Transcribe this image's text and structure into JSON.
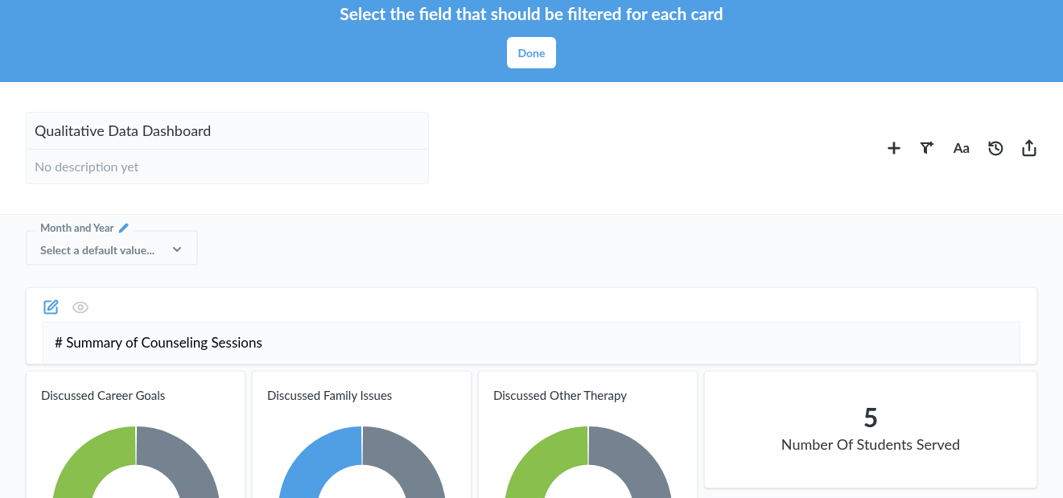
{
  "banner": {
    "title": "Select the field that should be filtered for each card",
    "button": "Done"
  },
  "dashboard": {
    "title": "Qualitative Data Dashboard",
    "description_placeholder": "No description yet"
  },
  "toolbar": [
    {
      "kind": "add"
    },
    {
      "kind": "filter"
    },
    {
      "kind": "text",
      "label": "Aa"
    },
    {
      "kind": "history"
    },
    {
      "kind": "share"
    }
  ],
  "filter": {
    "label": "Month and Year",
    "placeholder": "Select a default value..."
  },
  "text_card": {
    "content": "# Summary of Counseling Sessions"
  },
  "cards": [
    {
      "kind": "donut",
      "title": "Discussed Career Goals",
      "color": "#88bf4d"
    },
    {
      "kind": "donut",
      "title": "Discussed Family Issues",
      "color": "#509ee3"
    },
    {
      "kind": "donut",
      "title": "Discussed Other Therapy",
      "color": "#88bf4d"
    },
    {
      "kind": "scalar",
      "value": "5",
      "title": "Number Of Students Served"
    }
  ]
}
